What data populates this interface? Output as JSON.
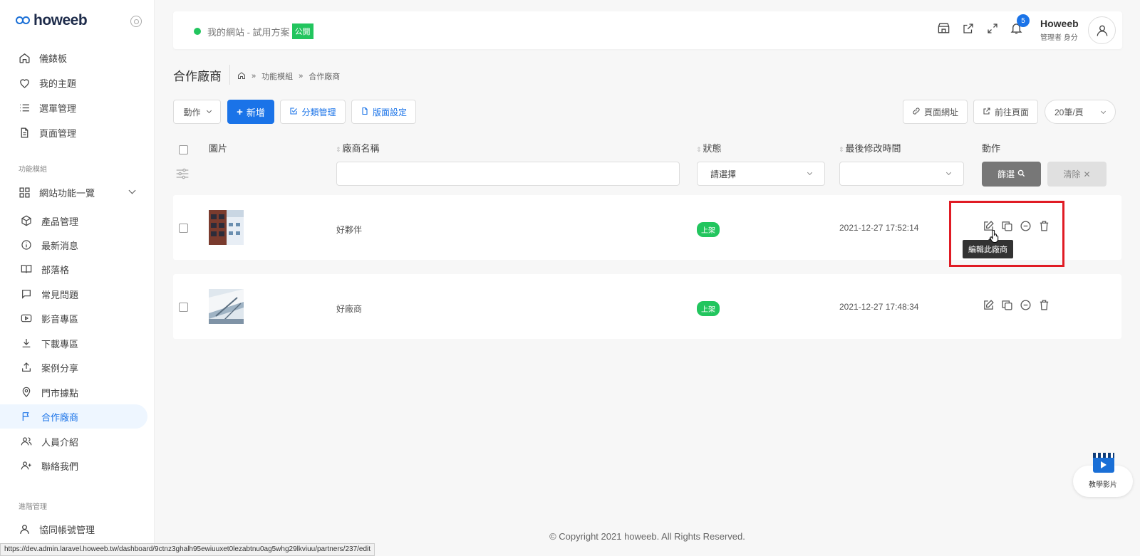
{
  "brand": {
    "name": "howeeb"
  },
  "sidebar": {
    "top_items": [
      {
        "label": "儀錶板",
        "icon": "home-icon"
      },
      {
        "label": "我的主題",
        "icon": "heart-icon"
      },
      {
        "label": "選單管理",
        "icon": "list-icon"
      },
      {
        "label": "頁面管理",
        "icon": "file-icon"
      }
    ],
    "section_modules": "功能模組",
    "group_label": "網站功能一覽",
    "module_items": [
      {
        "label": "產品管理",
        "icon": "box-icon"
      },
      {
        "label": "最新消息",
        "icon": "info-icon"
      },
      {
        "label": "部落格",
        "icon": "book-icon"
      },
      {
        "label": "常見問題",
        "icon": "chat-icon"
      },
      {
        "label": "影音專區",
        "icon": "video-icon"
      },
      {
        "label": "下載專區",
        "icon": "download-icon"
      },
      {
        "label": "案例分享",
        "icon": "share-icon"
      },
      {
        "label": "門市據點",
        "icon": "map-pin-icon"
      },
      {
        "label": "合作廠商",
        "icon": "flag-icon"
      },
      {
        "label": "人員介紹",
        "icon": "users-icon"
      },
      {
        "label": "聯絡我們",
        "icon": "user-plus-icon"
      }
    ],
    "section_advanced": "進階管理",
    "advanced_items": [
      {
        "label": "協同帳號管理",
        "icon": "user-icon"
      }
    ]
  },
  "header": {
    "site_name": "我的網站 - 試用方案",
    "public_badge": "公開",
    "notification_count": "5",
    "user_name": "Howeeb",
    "user_role": "管理者 身分"
  },
  "page": {
    "title": "合作廠商",
    "breadcrumb": [
      "功能模組",
      "合作廠商"
    ]
  },
  "toolbar": {
    "action_label": "動作",
    "add_label": "新增",
    "category_label": "分類管理",
    "layout_label": "版面設定",
    "page_url_label": "頁面網址",
    "goto_page_label": "前往頁面",
    "per_page_label": "20筆/頁"
  },
  "table": {
    "columns": {
      "image": "圖片",
      "name": "廠商名稱",
      "status": "狀態",
      "modified": "最後修改時間",
      "actions": "動作"
    },
    "status_placeholder": "請選擇",
    "filter_label": "篩選",
    "clear_label": "清除",
    "rows": [
      {
        "name": "好夥伴",
        "status": "上架",
        "modified": "2021-12-27 17:52:14"
      },
      {
        "name": "好廠商",
        "status": "上架",
        "modified": "2021-12-27 17:48:34"
      }
    ]
  },
  "tooltip": "編輯此廠商",
  "footer": "© Copyright 2021 howeeb. All Rights Reserved.",
  "status_url": "https://dev.admin.laravel.howeeb.tw/dashboard/9ctnz3ghalh95ewiuuxet0lezabtnu0ag5whg29lkviuu/partners/237/edit",
  "tutorial_label": "教學影片",
  "colors": {
    "primary": "#1a73e8",
    "success": "#22c55e",
    "highlight": "#e01b24"
  }
}
